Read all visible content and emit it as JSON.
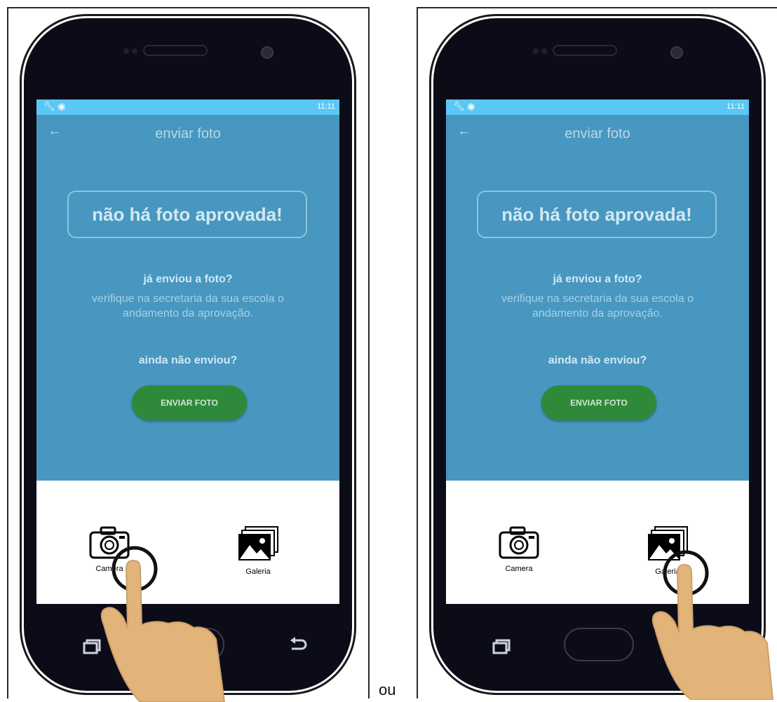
{
  "screens": [
    {
      "status_time": "11:11",
      "title": "enviar foto",
      "notice": "não há foto aprovada!",
      "question_sent": "já enviou a foto?",
      "description": "verifique na secretaria da sua escola o andamento da aprovação.",
      "question_not_sent": "ainda não enviou?",
      "send_button": "ENVIAR FOTO",
      "option_camera": "Camera",
      "option_gallery": "Galeria",
      "tap_target": "camera"
    },
    {
      "status_time": "11:11",
      "title": "enviar foto",
      "notice": "não há foto aprovada!",
      "question_sent": "já enviou a foto?",
      "description": "verifique na secretaria da sua escola o andamento da aprovação.",
      "question_not_sent": "ainda não enviou?",
      "send_button": "ENVIAR FOTO",
      "option_camera": "Camera",
      "option_gallery": "Galeria",
      "tap_target": "gallery"
    }
  ],
  "separator": "ou",
  "colors": {
    "app_background": "#4797c0",
    "status_bar": "#5ac8f5",
    "send_button": "#2e8a3a",
    "phone_body": "#0c0c18",
    "hand": "#e3b47a"
  }
}
